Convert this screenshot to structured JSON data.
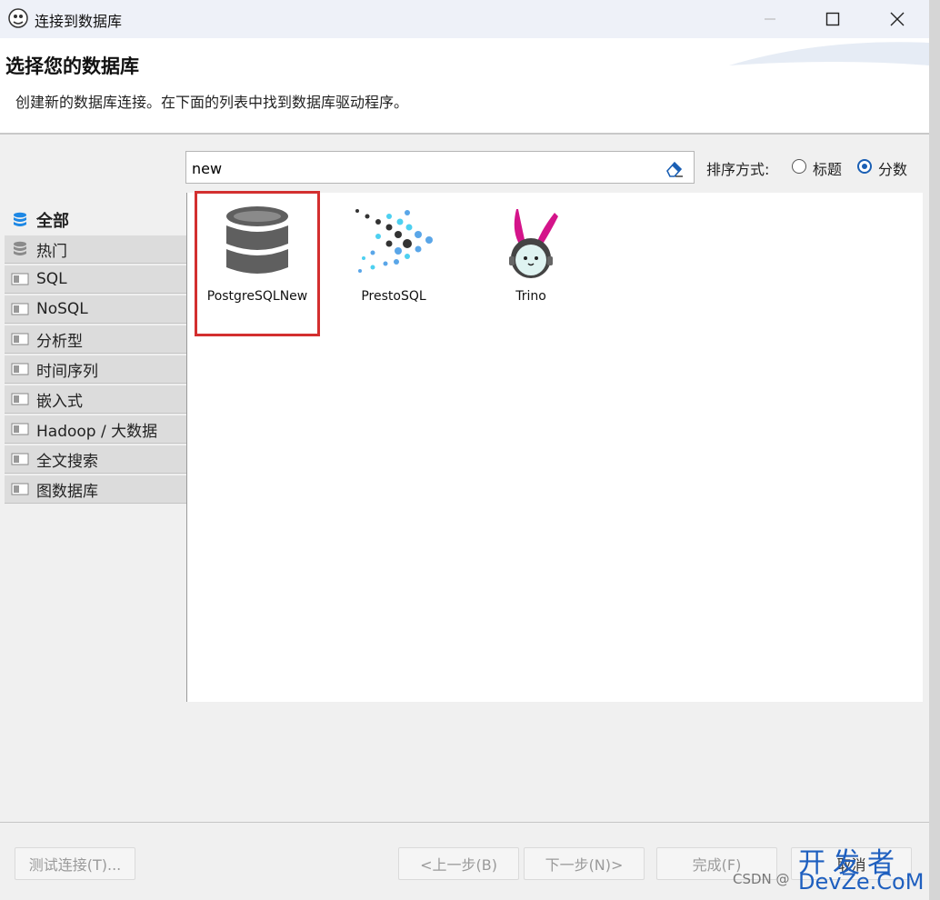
{
  "window": {
    "title": "连接到数据库",
    "minimize_icon": "minimize-icon",
    "maximize_icon": "maximize-icon",
    "close_icon": "close-icon"
  },
  "header": {
    "title": "选择您的数据库",
    "description": "创建新的数据库连接。在下面的列表中找到数据库驱动程序。"
  },
  "search": {
    "value": "new",
    "clear_icon": "eraser-icon"
  },
  "sort": {
    "label": "排序方式:",
    "options": [
      {
        "label": "标题",
        "checked": false
      },
      {
        "label": "分数",
        "checked": true
      }
    ]
  },
  "categories": [
    {
      "label": "全部",
      "icon": "database-stack-icon",
      "active": true
    },
    {
      "label": "热门",
      "icon": "database-stack-icon",
      "active": false
    },
    {
      "label": "SQL",
      "icon": "folder-icon",
      "active": false
    },
    {
      "label": "NoSQL",
      "icon": "folder-icon",
      "active": false
    },
    {
      "label": "分析型",
      "icon": "folder-icon",
      "active": false
    },
    {
      "label": "时间序列",
      "icon": "folder-icon",
      "active": false
    },
    {
      "label": "嵌入式",
      "icon": "folder-icon",
      "active": false
    },
    {
      "label": "Hadoop / 大数据",
      "icon": "folder-icon",
      "active": false
    },
    {
      "label": "全文搜索",
      "icon": "folder-icon",
      "active": false
    },
    {
      "label": "图数据库",
      "icon": "folder-icon",
      "active": false
    }
  ],
  "drivers": [
    {
      "label": "PostgreSQLNew",
      "icon": "database-icon",
      "selected": true
    },
    {
      "label": "PrestoSQL",
      "icon": "presto-dots-icon",
      "selected": false
    },
    {
      "label": "Trino",
      "icon": "trino-bunny-icon",
      "selected": false
    }
  ],
  "buttons": {
    "test": "测试连接(T)...",
    "back": "<上一步(B)",
    "next": "下一步(N)>",
    "finish": "完成(F)",
    "cancel": "取消"
  },
  "watermark": {
    "csdn": "CSDN @",
    "logo_top": "开发者",
    "logo_bottom": "DevZe.CoM"
  },
  "colors": {
    "selection_outline": "#d32f2f",
    "radio_accent": "#1a5fb4",
    "watermark_logo": "#1e5fbf"
  }
}
